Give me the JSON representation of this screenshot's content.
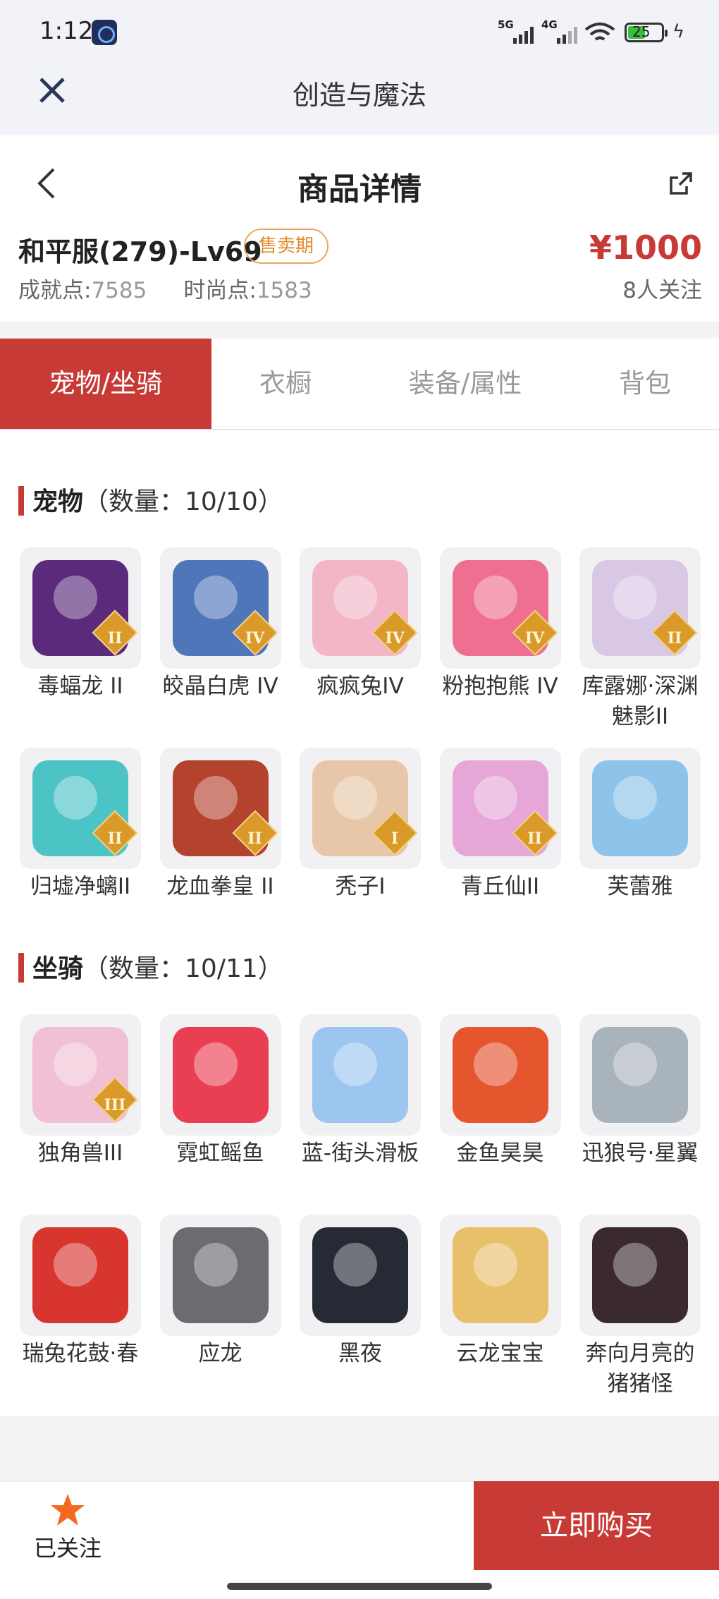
{
  "status": {
    "time": "1:12",
    "net1": "5G",
    "net2": "4G",
    "battery": "25"
  },
  "app": {
    "title": "创造与魔法"
  },
  "page": {
    "title": "商品详情"
  },
  "item": {
    "name": "和平服(279)-Lv69",
    "badge": "售卖期",
    "price": "¥1000",
    "achieve_label": "成就点:",
    "achieve_value": "7585",
    "fashion_label": "时尚点:",
    "fashion_value": "1583",
    "followers": "8人关注"
  },
  "tabs": [
    "宠物/坐骑",
    "衣橱",
    "装备/属性",
    "背包"
  ],
  "pets": {
    "title": "宠物",
    "count": "（数量：10/10）",
    "items": [
      {
        "label": "毒蝠龙 II",
        "tier": "II",
        "color": "#5b2a7a"
      },
      {
        "label": "皎晶白虎 IV",
        "tier": "IV",
        "color": "#4f76b8"
      },
      {
        "label": "疯疯兔IV",
        "tier": "IV",
        "color": "#f2b6c6"
      },
      {
        "label": "粉抱抱熊 IV",
        "tier": "IV",
        "color": "#ee6f8f"
      },
      {
        "label": "库露娜·深渊魅影II",
        "tier": "II",
        "color": "#d9c7e6"
      },
      {
        "label": "归墟净螭II",
        "tier": "II",
        "color": "#4cc3c5"
      },
      {
        "label": "龙血拳皇 II",
        "tier": "II",
        "color": "#b4432e"
      },
      {
        "label": "秃子I",
        "tier": "I",
        "color": "#e7c7a8"
      },
      {
        "label": "青丘仙II",
        "tier": "II",
        "color": "#e6a6d8"
      },
      {
        "label": "芙蕾雅",
        "tier": "",
        "color": "#8ec3ea"
      }
    ]
  },
  "mounts": {
    "title": "坐骑",
    "count": "（数量：10/11）",
    "items": [
      {
        "label": "独角兽III",
        "tier": "III",
        "color": "#f1c0d4"
      },
      {
        "label": "霓虹鳐鱼",
        "tier": "",
        "color": "#ea3f52"
      },
      {
        "label": "蓝-街头滑板",
        "tier": "",
        "color": "#9cc6ef"
      },
      {
        "label": "金鱼昊昊",
        "tier": "",
        "color": "#e5552e"
      },
      {
        "label": "迅狼号·星翼",
        "tier": "",
        "color": "#a9b3bc"
      },
      {
        "label": "瑞兔花鼓·春",
        "tier": "",
        "color": "#d7352d"
      },
      {
        "label": "应龙",
        "tier": "",
        "color": "#6b6b70"
      },
      {
        "label": "黑夜",
        "tier": "",
        "color": "#262a35"
      },
      {
        "label": "云龙宝宝",
        "tier": "",
        "color": "#e9c06a"
      },
      {
        "label": "奔向月亮的猪猪怪",
        "tier": "",
        "color": "#3a2a2e"
      }
    ]
  },
  "bottom": {
    "follow": "已关注",
    "buy": "立即购买"
  }
}
